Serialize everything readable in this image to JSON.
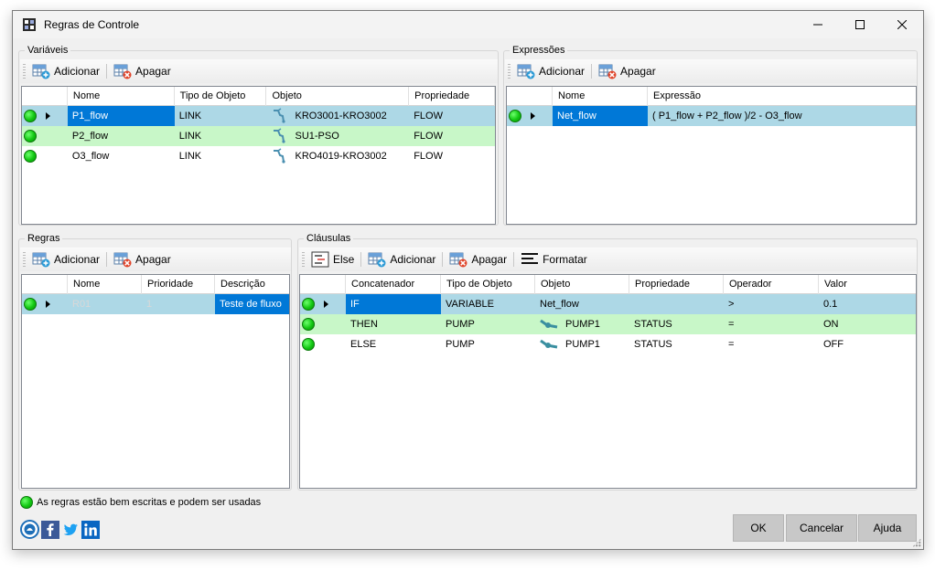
{
  "window": {
    "title": "Regras de Controle"
  },
  "variaveis": {
    "label": "Variáveis",
    "toolbar": {
      "add_label": "Adicionar",
      "delete_label": "Apagar"
    },
    "columns": [
      "Nome",
      "Tipo de Objeto",
      "Objeto",
      "Propriedade"
    ],
    "rows": [
      {
        "nome": "P1_flow",
        "tipo": "LINK",
        "objeto": "KRO3001-KRO3002",
        "propriedade": "FLOW"
      },
      {
        "nome": "P2_flow",
        "tipo": "LINK",
        "objeto": "SU1-PSO",
        "propriedade": "FLOW"
      },
      {
        "nome": "O3_flow",
        "tipo": "LINK",
        "objeto": "KRO4019-KRO3002",
        "propriedade": "FLOW"
      }
    ]
  },
  "expressoes": {
    "label": "Expressões",
    "toolbar": {
      "add_label": "Adicionar",
      "delete_label": "Apagar"
    },
    "columns": [
      "Nome",
      "Expressão"
    ],
    "rows": [
      {
        "nome": "Net_flow",
        "expressao": "( P1_flow + P2_flow )/2 - O3_flow"
      }
    ]
  },
  "regras": {
    "label": "Regras",
    "toolbar": {
      "add_label": "Adicionar",
      "delete_label": "Apagar"
    },
    "columns": [
      "Nome",
      "Prioridade",
      "Descrição"
    ],
    "rows": [
      {
        "nome": "R01",
        "prioridade": "1",
        "descricao": "Teste de fluxo"
      }
    ]
  },
  "clausulas": {
    "label": "Cláusulas",
    "toolbar": {
      "else_label": "Else",
      "add_label": "Adicionar",
      "delete_label": "Apagar",
      "format_label": "Formatar"
    },
    "columns": [
      "Concatenador",
      "Tipo de Objeto",
      "Objeto",
      "Propriedade",
      "Operador",
      "Valor"
    ],
    "rows": [
      {
        "concatenador": "IF",
        "tipo": "VARIABLE",
        "objeto": "Net_flow",
        "propriedade": "",
        "operador": ">",
        "valor": "0.1"
      },
      {
        "concatenador": "THEN",
        "tipo": "PUMP",
        "objeto": "PUMP1",
        "propriedade": "STATUS",
        "operador": "=",
        "valor": "ON"
      },
      {
        "concatenador": "ELSE",
        "tipo": "PUMP",
        "objeto": "PUMP1",
        "propriedade": "STATUS",
        "operador": "=",
        "valor": "OFF"
      }
    ]
  },
  "status_message": "As regras estão bem escritas e podem ser usadas",
  "buttons": {
    "ok": "OK",
    "cancel": "Cancelar",
    "help": "Ajuda"
  },
  "colors": {
    "selected_row": "#add8e6",
    "green_row": "#c8f7c8",
    "focus_cell": "#0078d7",
    "status_ok": "#12c712"
  },
  "icons": [
    "app-icon",
    "minimize-icon",
    "maximize-icon",
    "close-icon",
    "add-grid-icon",
    "delete-grid-icon",
    "link-icon",
    "pump-icon",
    "else-icon",
    "format-icon",
    "help-circle-icon",
    "facebook-icon",
    "twitter-icon",
    "linkedin-icon"
  ]
}
